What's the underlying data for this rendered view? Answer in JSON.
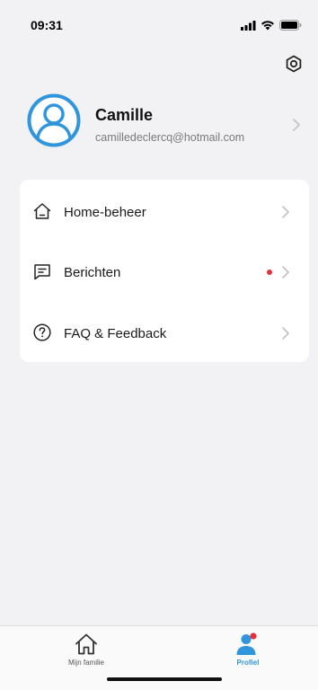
{
  "status_bar": {
    "time": "09:31"
  },
  "header": {
    "settings_icon": "settings-icon"
  },
  "profile": {
    "name": "Camille",
    "email": "camilledeclercq@hotmail.com",
    "avatar_color": "#2f95dc"
  },
  "menu": {
    "items": [
      {
        "label": "Home-beheer",
        "icon": "house-icon",
        "badge": false
      },
      {
        "label": "Berichten",
        "icon": "message-icon",
        "badge": true
      },
      {
        "label": "FAQ & Feedback",
        "icon": "question-icon",
        "badge": false
      }
    ]
  },
  "tab_bar": {
    "tabs": [
      {
        "label": "Mijn familie",
        "icon": "house-icon",
        "active": false
      },
      {
        "label": "Profiel",
        "icon": "person-icon",
        "active": true
      }
    ]
  },
  "colors": {
    "accent": "#2f95dc",
    "badge": "#e5303b",
    "background": "#f2f2f4"
  }
}
